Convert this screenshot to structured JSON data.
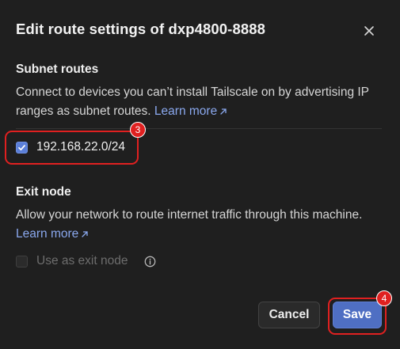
{
  "dialog": {
    "title": "Edit route settings of dxp4800-8888",
    "close_icon": "close-icon"
  },
  "subnet": {
    "heading": "Subnet routes",
    "description": "Connect to devices you can’t install Tailscale on by advertising IP ranges as subnet routes.",
    "learn_more": "Learn more",
    "routes": [
      {
        "label": "192.168.22.0/24",
        "checked": true
      }
    ]
  },
  "exit_node": {
    "heading": "Exit node",
    "description": "Allow your network to route internet traffic through this machine.",
    "learn_more": "Learn more",
    "option_label": "Use as exit node",
    "option_checked": false,
    "option_disabled": true,
    "info_icon": "info-icon"
  },
  "buttons": {
    "cancel": "Cancel",
    "save": "Save"
  },
  "annotations": {
    "route_badge": "3",
    "save_badge": "4",
    "color": "#e02020"
  },
  "colors": {
    "accent": "#5b7fd8",
    "link": "#8aa8ee",
    "save_button": "#4f6fc3",
    "background": "#1f1f1f"
  }
}
